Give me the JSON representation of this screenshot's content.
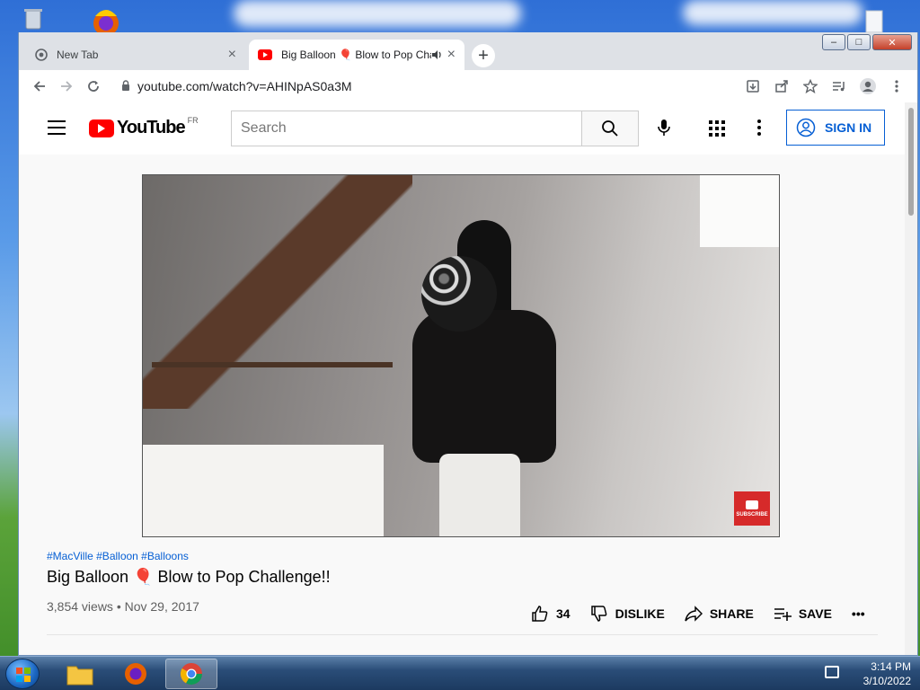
{
  "browser": {
    "tabs": [
      {
        "title": "New Tab",
        "active": false
      },
      {
        "title": "Big Balloon 🎈 Blow to Pop Challenge!!",
        "active": true
      }
    ],
    "new_tab_symbol": "+",
    "url": "youtube.com/watch?v=AHINpAS0a3M",
    "window_controls": {
      "minimize": "–",
      "maximize": "□",
      "close": "✕"
    }
  },
  "youtube": {
    "logo_text": "YouTube",
    "region": "FR",
    "search_placeholder": "Search",
    "sign_in_label": "SIGN IN",
    "video": {
      "hashtags": "#MacVille #Balloon #Balloons",
      "title": "Big Balloon 🎈 Blow to Pop Challenge!!",
      "views_date": "3,854 views • Nov 29, 2017",
      "subscribe_badge": "SUBSCRIBE"
    },
    "actions": {
      "like_count": "34",
      "dislike_label": "DISLIKE",
      "share_label": "SHARE",
      "save_label": "SAVE",
      "more_label": "•••"
    }
  },
  "taskbar": {
    "time": "3:14 PM",
    "date": "3/10/2022"
  },
  "colors": {
    "youtube_red": "#ff0000",
    "link_blue": "#065fd4",
    "chrome_frame": "#dee1e6"
  }
}
